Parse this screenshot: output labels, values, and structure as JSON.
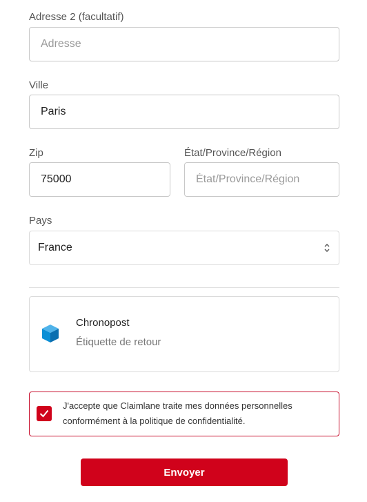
{
  "form": {
    "address2": {
      "label": "Adresse 2 (facultatif)",
      "placeholder": "Adresse",
      "value": ""
    },
    "city": {
      "label": "Ville",
      "value": "Paris"
    },
    "zip": {
      "label": "Zip",
      "value": "75000"
    },
    "state": {
      "label": "État/Province/Région",
      "placeholder": "État/Province/Région",
      "value": ""
    },
    "country": {
      "label": "Pays",
      "selected": "France"
    }
  },
  "carrier": {
    "name": "Chronopost",
    "subtitle": "Étiquette de retour",
    "icon": "box-icon",
    "icon_color": "#0b8fd6"
  },
  "consent": {
    "checked": true,
    "text": "J'accepte que Claimlane traite mes données personnelles conformément à la politique de confidentialité."
  },
  "submit": {
    "label": "Envoyer"
  },
  "colors": {
    "accent": "#d0021b",
    "border": "#c8c8c8",
    "text_muted": "#777777"
  }
}
